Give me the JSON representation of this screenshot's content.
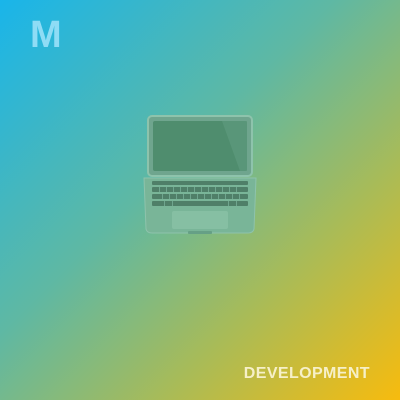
{
  "card": {
    "letter": "M",
    "category": "DEVELOPMENT",
    "icon": "laptop-icon"
  },
  "colors": {
    "gradient_start": "#19b5ea",
    "gradient_mid": "#5fb8a3",
    "gradient_end": "#f7bb0e",
    "letter_color": "#8fdcf5",
    "category_color": "#f6f0c8"
  }
}
